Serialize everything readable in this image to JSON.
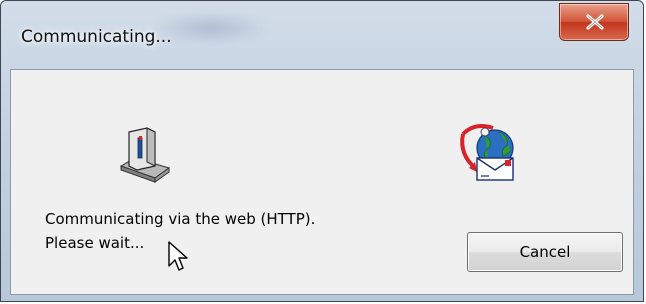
{
  "window": {
    "title": "Communicating...",
    "close_symbol": "x"
  },
  "dialog": {
    "message_line1": "Communicating via the web (HTTP).",
    "message_line2": "Please wait...",
    "cancel_label": "Cancel"
  },
  "icons": {
    "left": "computer-disk-icon",
    "right": "globe-mail-icon",
    "pointer": "mouse-cursor-icon"
  },
  "colors": {
    "close_button": "#c9442a",
    "client_background": "#f0f0f0"
  }
}
